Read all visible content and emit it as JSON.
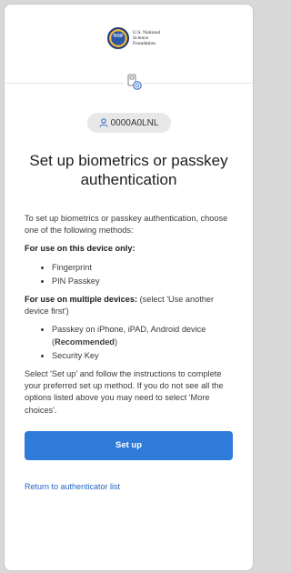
{
  "logo": {
    "seal_text": "NSF",
    "line1": "U.S. National",
    "line2": "Science",
    "line3": "Foundation"
  },
  "user": {
    "icon": "person-icon",
    "id": "0000A0LNL"
  },
  "title": "Set up biometrics or passkey authentication",
  "intro": "To set up biometrics or passkey authentication, choose one of the following methods:",
  "device_only": {
    "heading": "For use on this device only:",
    "items": [
      "Fingerprint",
      "PIN Passkey"
    ]
  },
  "multi_device": {
    "heading": "For use on multiple devices:",
    "note": " (select 'Use another device first')",
    "item1_prefix": "Passkey on iPhone, iPAD, Android device (",
    "item1_bold": "Recommended",
    "item1_suffix": ")",
    "item2": "Security Key"
  },
  "instructions": "Select 'Set up' and follow the instructions to complete your preferred set up method. If you do not see all the options listed above you may need to select 'More choices'.",
  "setup_button": "Set up",
  "return_link": "Return to authenticator list",
  "colors": {
    "primary": "#2f7bd9",
    "link": "#2366c2",
    "chip_bg": "#e8e8e8",
    "user_icon": "#3b6fd4"
  }
}
